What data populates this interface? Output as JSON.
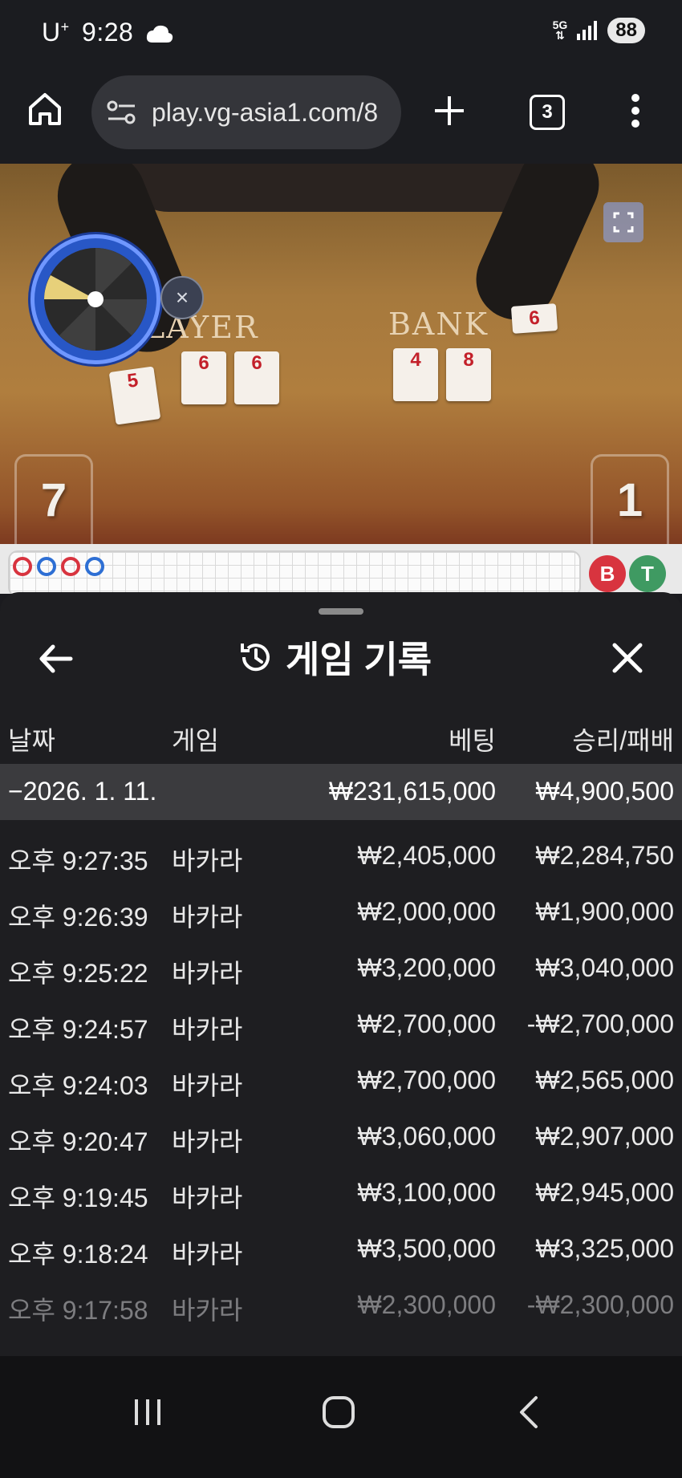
{
  "status_bar": {
    "carrier": "U",
    "carrier_sup": "+",
    "time": "9:28",
    "network": "5G",
    "battery": "88"
  },
  "browser": {
    "url": "play.vg-asia1.com/8",
    "tab_count": "3"
  },
  "video": {
    "player_label": "LAYER",
    "banker_label": "BANK",
    "player_score": "7",
    "banker_score": "1",
    "player_cards": [
      "5",
      "6",
      "6"
    ],
    "banker_cards": [
      "4",
      "8",
      "6"
    ]
  },
  "roadmap": {
    "banker_btn": "B",
    "tie_btn": "T"
  },
  "sheet": {
    "title": "게임 기록",
    "columns": {
      "date": "날짜",
      "game": "게임",
      "bet": "베팅",
      "winloss": "승리/패배"
    },
    "summary": {
      "date": "−2026. 1. 11.",
      "bet": "₩231,615,000",
      "winloss": "₩4,900,500"
    },
    "rows": [
      {
        "time": "오후 9:27:35",
        "game": "바카라",
        "bet": "₩2,405,000",
        "winloss": "₩2,284,750"
      },
      {
        "time": "오후 9:26:39",
        "game": "바카라",
        "bet": "₩2,000,000",
        "winloss": "₩1,900,000"
      },
      {
        "time": "오후 9:25:22",
        "game": "바카라",
        "bet": "₩3,200,000",
        "winloss": "₩3,040,000"
      },
      {
        "time": "오후 9:24:57",
        "game": "바카라",
        "bet": "₩2,700,000",
        "winloss": "-₩2,700,000"
      },
      {
        "time": "오후 9:24:03",
        "game": "바카라",
        "bet": "₩2,700,000",
        "winloss": "₩2,565,000"
      },
      {
        "time": "오후 9:20:47",
        "game": "바카라",
        "bet": "₩3,060,000",
        "winloss": "₩2,907,000"
      },
      {
        "time": "오후 9:19:45",
        "game": "바카라",
        "bet": "₩3,100,000",
        "winloss": "₩2,945,000"
      },
      {
        "time": "오후 9:18:24",
        "game": "바카라",
        "bet": "₩3,500,000",
        "winloss": "₩3,325,000"
      },
      {
        "time": "오후 9:17:58",
        "game": "바카라",
        "bet": "₩2,300,000",
        "winloss": "-₩2,300,000"
      }
    ]
  },
  "colors": {
    "accent_red": "#d8343f",
    "accent_green": "#3f9a62",
    "sheet_bg": "#1e1e21",
    "summary_bg": "#3b3b3e"
  },
  "icons": [
    "home-icon",
    "site-settings-icon",
    "new-tab-icon",
    "tab-switcher-icon",
    "more-menu-icon",
    "expand-icon",
    "history-icon",
    "back-arrow-icon",
    "close-icon",
    "recent-apps-icon",
    "home-nav-icon",
    "back-nav-icon"
  ]
}
